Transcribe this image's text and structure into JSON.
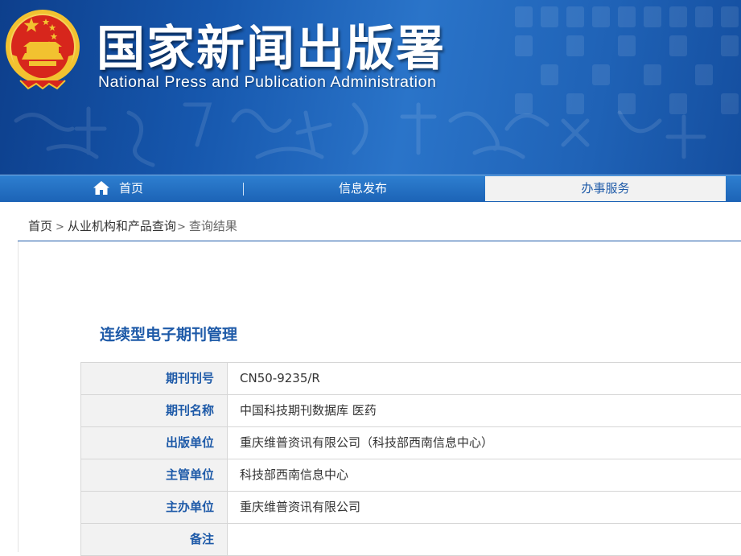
{
  "header": {
    "title_cn": "国家新闻出版署",
    "title_en": "National  Press and Publication Administration",
    "emblem_icon": "national-emblem-icon"
  },
  "nav": {
    "home": "首页",
    "home_icon": "home-icon",
    "news": "信息发布",
    "service": "办事服务"
  },
  "breadcrumb": {
    "items": [
      "首页",
      "从业机构和产品查询"
    ],
    "separator": ">",
    "current": "查询结果"
  },
  "section": {
    "title": "连续型电子期刊管理"
  },
  "table": {
    "rows": [
      {
        "label": "期刊刊号",
        "value": "CN50-9235/R"
      },
      {
        "label": "期刊名称",
        "value": "中国科技期刊数据库 医药"
      },
      {
        "label": "出版单位",
        "value": "重庆维普资讯有限公司（科技部西南信息中心）"
      },
      {
        "label": "主管单位",
        "value": "科技部西南信息中心"
      },
      {
        "label": "主办单位",
        "value": "重庆维普资讯有限公司"
      },
      {
        "label": "备注",
        "value": ""
      }
    ]
  },
  "colors": {
    "brand_blue": "#1e5aa8",
    "emblem_red": "#d7261c",
    "emblem_gold": "#f2c230"
  }
}
